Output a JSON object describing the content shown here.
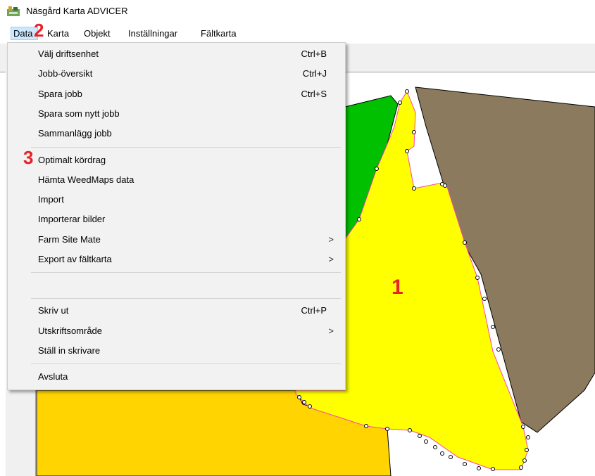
{
  "window": {
    "title": "Näsgård Karta ADVICER"
  },
  "menubar": {
    "items": [
      {
        "label": "Data"
      },
      {
        "label": "Karta"
      },
      {
        "label": "Objekt"
      },
      {
        "label": "Inställningar"
      },
      {
        "label": "Fältkarta"
      }
    ]
  },
  "dropdown": {
    "items": [
      {
        "label": "Välj driftsenhet",
        "shortcut": "Ctrl+B"
      },
      {
        "label": "Jobb-översikt",
        "shortcut": "Ctrl+J"
      },
      {
        "label": "Spara jobb",
        "shortcut": "Ctrl+S"
      },
      {
        "label": "Spara som nytt jobb",
        "shortcut": ""
      },
      {
        "label": "Sammanlägg jobb",
        "shortcut": ""
      },
      {
        "label": "Optimalt kördrag",
        "shortcut": ""
      },
      {
        "label": "Hämta WeedMaps data",
        "shortcut": ""
      },
      {
        "label": "Import",
        "shortcut": ""
      },
      {
        "label": "Importerar bilder",
        "shortcut": ""
      },
      {
        "label": "Farm Site Mate",
        "shortcut": "",
        "submenu": ">"
      },
      {
        "label": "Export av fältkarta",
        "shortcut": "",
        "submenu": ">"
      },
      {
        "label": "Skriv ut",
        "shortcut": "Ctrl+P"
      },
      {
        "label": "Utskriftsområde",
        "shortcut": "",
        "submenu": ">"
      },
      {
        "label": "Ställ in skrivare",
        "shortcut": ""
      },
      {
        "label": "Avsluta",
        "shortcut": ""
      }
    ]
  },
  "annotations": {
    "one": "1",
    "two": "2",
    "three": "3"
  },
  "colors": {
    "field_selected": "#ffff00",
    "field_green": "#00c000",
    "field_brown": "#8b7a5e",
    "field_orange": "#ffd400",
    "field_border": "#ff44aa",
    "annotation": "#e8222a"
  }
}
